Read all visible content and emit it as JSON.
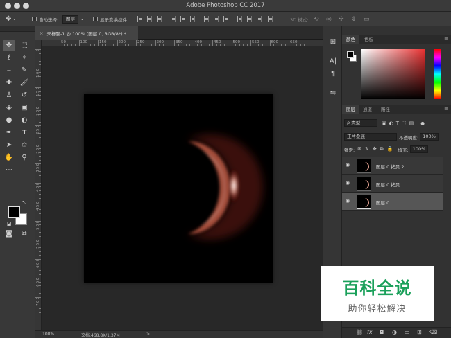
{
  "app": {
    "title": "Adobe Photoshop CC 2017"
  },
  "options_bar": {
    "auto_select_label": "自动选择:",
    "auto_select_value": "图层",
    "show_transform_label": "显示变换控件",
    "mode_3d_label": "3D 模式:"
  },
  "document": {
    "tab_title": "未标题-1 @ 100% (图层 0, RGB/8*) *",
    "ruler_h_ticks": [
      "50",
      "100",
      "150",
      "200",
      "250",
      "300",
      "350",
      "400",
      "450",
      "500",
      "550",
      "600",
      "650"
    ],
    "ruler_v_ticks": [
      "5",
      "1 0 0",
      "1 5 0",
      "2 0 0",
      "2 5 0",
      "3 0 0",
      "3 5 0",
      "4 0 0",
      "4 5 0",
      "5 0 0",
      "5 5 0",
      "6 0 0",
      "6 5 0",
      "7 0 0"
    ]
  },
  "status_bar": {
    "zoom": "100%",
    "doc_info": "文档:468.8K/1.37M",
    "arrow": ">"
  },
  "color_panel": {
    "tabs": [
      "颜色",
      "色板"
    ],
    "active_tab": 0,
    "foreground": "#000000",
    "background": "#ffffff"
  },
  "layers_panel": {
    "tabs": [
      "图层",
      "通道",
      "路径"
    ],
    "filter_label": "ρ 类型",
    "blend_mode": "正片叠底",
    "opacity_label": "不透明度:",
    "opacity_value": "100%",
    "lock_label": "锁定:",
    "fill_label": "填充:",
    "fill_value": "100%",
    "layers": [
      {
        "name": "图层 0 拷贝 2",
        "selected": false
      },
      {
        "name": "图层 0 拷贝",
        "selected": false
      },
      {
        "name": "图层 0",
        "selected": true
      }
    ],
    "bottom_icons": [
      "link-icon",
      "fx-icon",
      "mask-icon",
      "adjustment-icon",
      "group-icon",
      "new-layer-icon",
      "trash-icon"
    ],
    "fx_label": "fx"
  },
  "watermark": {
    "main": "百科全说",
    "sub": "助你轻松解决"
  },
  "colors": {
    "accent_green": "#1aa05a",
    "canvas_bg": "#000000",
    "workspace_bg": "#282828"
  }
}
